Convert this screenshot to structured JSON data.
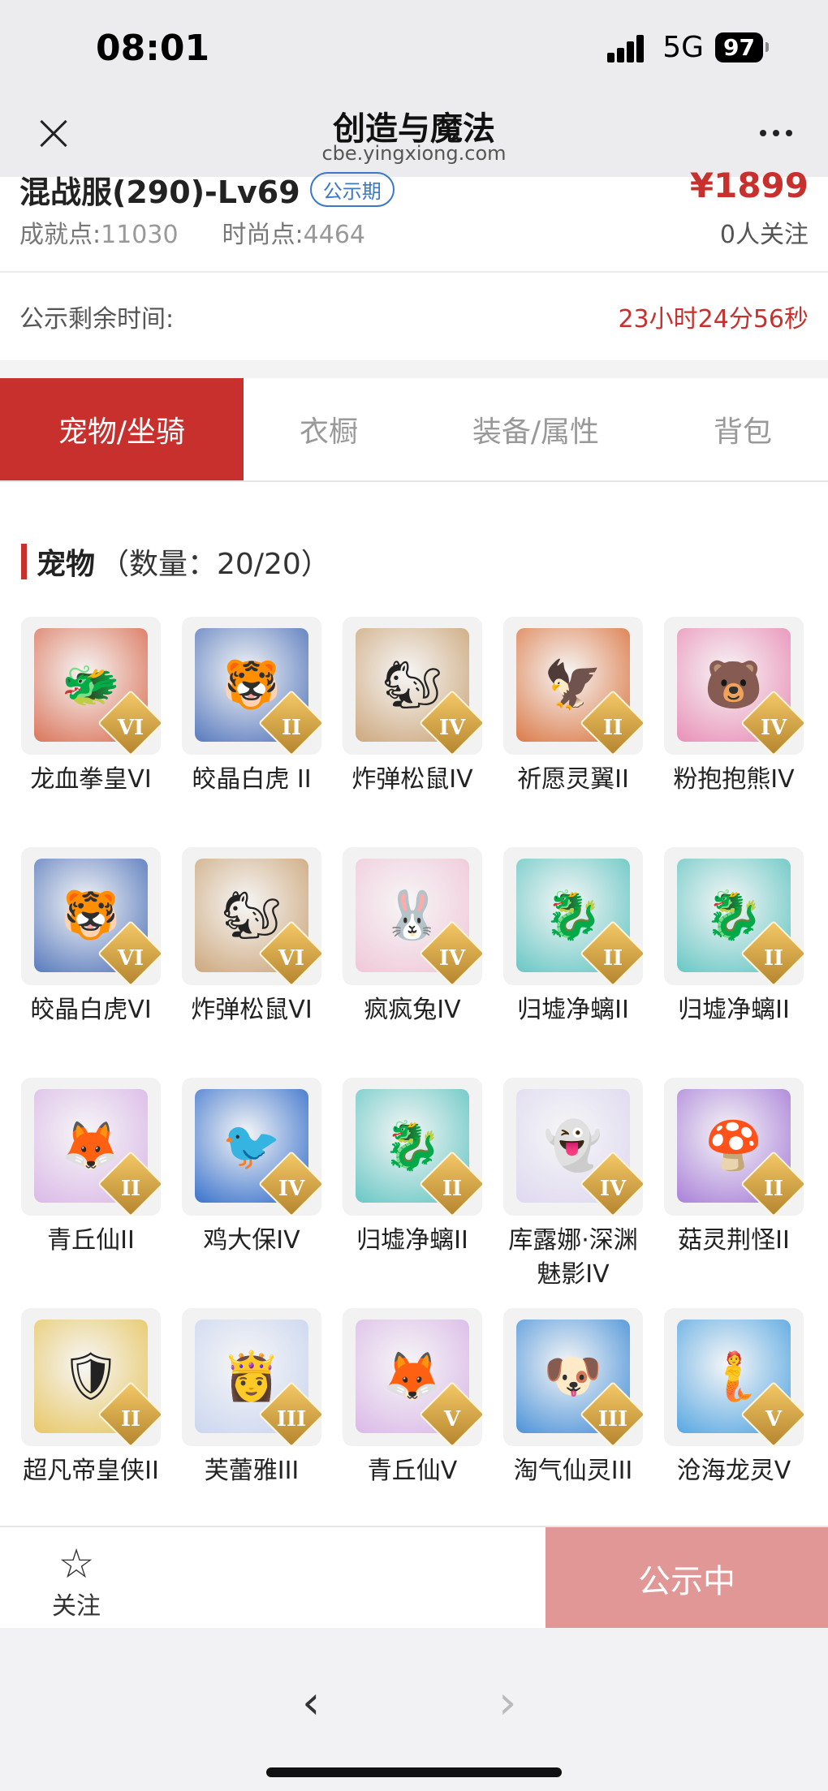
{
  "status": {
    "time": "08:01",
    "network": "5G",
    "battery": "97"
  },
  "nav": {
    "title": "创造与魔法",
    "url": "cbe.yingxiong.com"
  },
  "listing": {
    "server": "混战服(290)-Lv69",
    "tag": "公示期",
    "price": "¥1899",
    "achievement_label": "成就点:",
    "achievement_value": "11030",
    "fashion_label": "时尚点:",
    "fashion_value": "4464",
    "followers": "0人关注",
    "countdown_label": "公示剩余时间:",
    "countdown_value": "23小时24分56秒"
  },
  "tabs": [
    {
      "label": "宠物/坐骑",
      "active": true
    },
    {
      "label": "衣橱"
    },
    {
      "label": "装备/属性"
    },
    {
      "label": "背包"
    }
  ],
  "section": {
    "title": "宠物",
    "count": "（数量：20/20）"
  },
  "pets": [
    {
      "name": "龙血拳皇VI",
      "rank": "VI",
      "icon": "dragon-beast-icon",
      "glyph": "🐲",
      "color": "#d86a4e"
    },
    {
      "name": "皎晶白虎 II",
      "rank": "II",
      "icon": "white-tiger-icon",
      "glyph": "🐯",
      "color": "#4a6fb8"
    },
    {
      "name": "炸弹松鼠IV",
      "rank": "IV",
      "icon": "squirrel-icon",
      "glyph": "🐿",
      "color": "#c9a173"
    },
    {
      "name": "祈愿灵翼II",
      "rank": "II",
      "icon": "eagle-icon",
      "glyph": "🦅",
      "color": "#d9703a"
    },
    {
      "name": "粉抱抱熊IV",
      "rank": "IV",
      "icon": "pink-bear-icon",
      "glyph": "🐻",
      "color": "#e887b2"
    },
    {
      "name": "皎晶白虎VI",
      "rank": "VI",
      "icon": "white-tiger-icon",
      "glyph": "🐯",
      "color": "#4a6fb8"
    },
    {
      "name": "炸弹松鼠VI",
      "rank": "VI",
      "icon": "squirrel-icon",
      "glyph": "🐿",
      "color": "#c9a173"
    },
    {
      "name": "疯疯兔IV",
      "rank": "IV",
      "icon": "rabbit-icon",
      "glyph": "🐰",
      "color": "#efc4d6"
    },
    {
      "name": "归墟净螭II",
      "rank": "II",
      "icon": "sea-dragon-icon",
      "glyph": "🐉",
      "color": "#5cc3c0"
    },
    {
      "name": "归墟净螭II",
      "rank": "II",
      "icon": "sea-dragon-icon",
      "glyph": "🐉",
      "color": "#5cc3c0"
    },
    {
      "name": "青丘仙II",
      "rank": "II",
      "icon": "fox-fairy-icon",
      "glyph": "🦊",
      "color": "#d8b4e6"
    },
    {
      "name": "鸡大保IV",
      "rank": "IV",
      "icon": "blue-bird-icon",
      "glyph": "🐦",
      "color": "#2a67c8"
    },
    {
      "name": "归墟净螭II",
      "rank": "II",
      "icon": "sea-dragon-icon",
      "glyph": "🐉",
      "color": "#5cc3c0"
    },
    {
      "name": "库露娜·深渊魅影IV",
      "rank": "IV",
      "icon": "spirit-girl-icon",
      "glyph": "👻",
      "color": "#dcd6f0"
    },
    {
      "name": "菇灵荆怪II",
      "rank": "II",
      "icon": "mushroom-sprite-icon",
      "glyph": "🍄",
      "color": "#a377d6"
    },
    {
      "name": "超凡帝皇侠II",
      "rank": "II",
      "icon": "armored-hero-icon",
      "glyph": "🛡",
      "color": "#e6c35a"
    },
    {
      "name": "芙蕾雅III",
      "rank": "III",
      "icon": "valkyrie-icon",
      "glyph": "👸",
      "color": "#c7d3ef"
    },
    {
      "name": "青丘仙V",
      "rank": "V",
      "icon": "fox-fairy-icon",
      "glyph": "🦊",
      "color": "#d8b4e6"
    },
    {
      "name": "淘气仙灵III",
      "rank": "III",
      "icon": "blue-dog-icon",
      "glyph": "🐶",
      "color": "#3d8ad6"
    },
    {
      "name": "沧海龙灵V",
      "rank": "V",
      "icon": "dragon-girl-icon",
      "glyph": "🧜",
      "color": "#4aa0e0"
    }
  ],
  "bottom": {
    "follow_label": "关注",
    "status_label": "公示中"
  }
}
